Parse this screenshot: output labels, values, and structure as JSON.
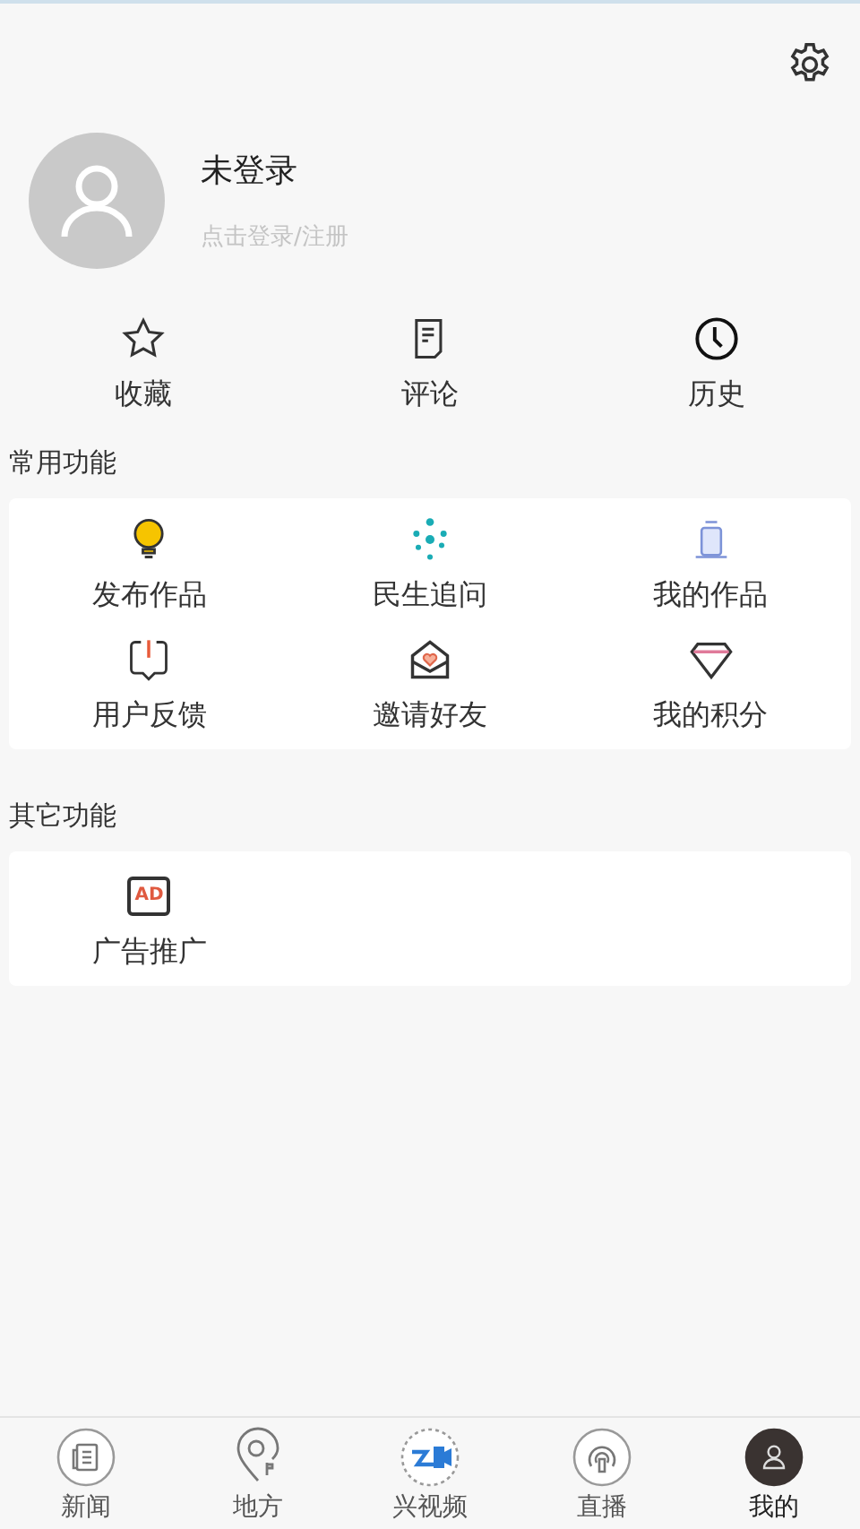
{
  "profile": {
    "name": "未登录",
    "login_hint": "点击登录/注册"
  },
  "quick_actions": [
    {
      "label": "收藏"
    },
    {
      "label": "评论"
    },
    {
      "label": "历史"
    }
  ],
  "common_functions": {
    "title": "常用功能",
    "items": [
      {
        "label": "发布作品"
      },
      {
        "label": "民生追问"
      },
      {
        "label": "我的作品"
      },
      {
        "label": "用户反馈"
      },
      {
        "label": "邀请好友"
      },
      {
        "label": "我的积分"
      }
    ]
  },
  "other_functions": {
    "title": "其它功能",
    "items": [
      {
        "label": "广告推广",
        "badge": "AD"
      }
    ]
  },
  "bottom_nav": [
    {
      "label": "新闻",
      "selected": false
    },
    {
      "label": "地方",
      "selected": false
    },
    {
      "label": "兴视频",
      "selected": false
    },
    {
      "label": "直播",
      "selected": false
    },
    {
      "label": "我的",
      "selected": true
    }
  ]
}
